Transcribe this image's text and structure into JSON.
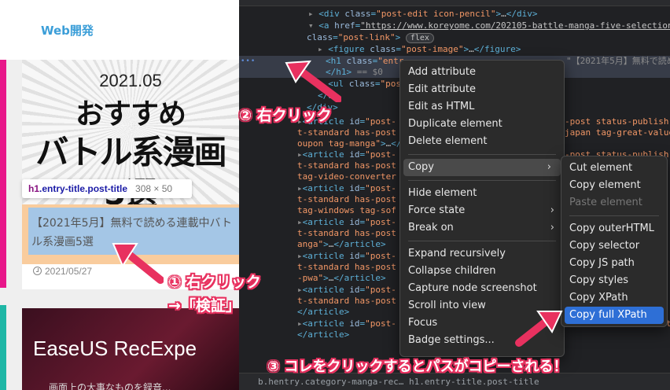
{
  "web": {
    "nav_label": "Web開発",
    "thumbnail": {
      "date": "2021.05",
      "line1": "おすすめ",
      "line2": "バトル系漫画",
      "line3": "5選"
    },
    "tooltip": {
      "tag": "h1",
      "classes": ".entry-title.post-title",
      "dimensions": "308 × 50"
    },
    "post_title": "【2021年5月】無料で読める連載中バトル系漫画5選",
    "post_date": "2021/05/27",
    "card2_title": "EaseUS RecExpe",
    "card2_sub": "画面上の大事なものを録音..."
  },
  "devtools": {
    "breadcrumb": "b.hentry.category-manga-rec…   h1.entry-title.post-title"
  },
  "menu_main": {
    "items": [
      {
        "label": "Add attribute"
      },
      {
        "label": "Edit attribute"
      },
      {
        "label": "Edit as HTML"
      },
      {
        "label": "Duplicate element"
      },
      {
        "label": "Delete element"
      },
      {
        "label": "Copy"
      },
      {
        "label": "Hide element"
      },
      {
        "label": "Force state"
      },
      {
        "label": "Break on"
      },
      {
        "label": "Expand recursively"
      },
      {
        "label": "Collapse children"
      },
      {
        "label": "Capture node screenshot"
      },
      {
        "label": "Scroll into view"
      },
      {
        "label": "Focus"
      },
      {
        "label": "Badge settings..."
      }
    ]
  },
  "menu_copy": {
    "items": [
      {
        "label": "Cut element"
      },
      {
        "label": "Copy element"
      },
      {
        "label": "Paste element"
      },
      {
        "label": "Copy outerHTML"
      },
      {
        "label": "Copy selector"
      },
      {
        "label": "Copy JS path"
      },
      {
        "label": "Copy styles"
      },
      {
        "label": "Copy XPath"
      },
      {
        "label": "Copy full XPath"
      }
    ]
  },
  "annotations": {
    "step1_line1": "① 右クリック",
    "step1_line2": "→「検証」",
    "step2": "② 右クリック",
    "step3": "③ コレをクリックするとパスがコピーされる！"
  },
  "colors": {
    "annotation_pink": "#e8315f",
    "menu_highlight": "#2e6fd6",
    "devtools_bg": "#202124",
    "nav_blue": "#3b9ed8"
  }
}
